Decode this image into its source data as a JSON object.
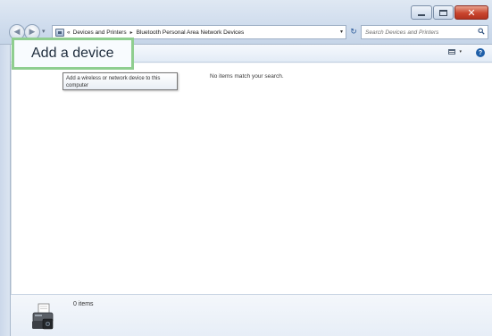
{
  "window": {
    "caption": {
      "minimize_icon": "minimize-icon",
      "maximize_icon": "maximize-icon",
      "close_glyph": "✕"
    }
  },
  "nav": {
    "back_glyph": "◀",
    "forward_glyph": "▶",
    "dropdown_glyph": "▾",
    "refresh_glyph": "↻"
  },
  "address": {
    "overflow_chevron": "«",
    "crumbs": [
      "Devices and Printers",
      "Bluetooth Personal Area Network Devices"
    ],
    "separator": "▸",
    "dropdown_glyph": "▾"
  },
  "search": {
    "placeholder": "Search Devices and Printers"
  },
  "toolbar": {
    "add_device_label": "Add a device",
    "view_dropdown_glyph": "▾",
    "help_label": "?"
  },
  "tooltip": {
    "text": "Add a wireless or network device to this computer"
  },
  "content": {
    "empty_message": "No items match your search."
  },
  "details": {
    "items_count": "0 items"
  },
  "colors": {
    "highlight_border": "#8fce8f",
    "accent": "#1f5fa8"
  }
}
